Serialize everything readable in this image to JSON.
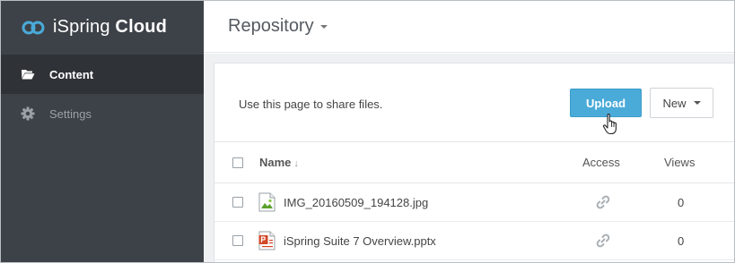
{
  "sidebar": {
    "brand": {
      "name_light": "iSpring",
      "name_bold": "Cloud"
    },
    "items": [
      {
        "label": "Content",
        "icon": "folder-open-icon",
        "active": true
      },
      {
        "label": "Settings",
        "icon": "gear-icon",
        "active": false
      }
    ]
  },
  "header": {
    "title": "Repository"
  },
  "panel": {
    "intro": "Use this page to share files.",
    "upload_label": "Upload",
    "new_label": "New"
  },
  "table": {
    "columns": {
      "name": "Name",
      "access": "Access",
      "views": "Views"
    },
    "rows": [
      {
        "name": "IMG_20160509_194128.jpg",
        "type": "image",
        "views": "0"
      },
      {
        "name": "iSpring Suite 7 Overview.pptx",
        "type": "pptx",
        "views": "0"
      }
    ]
  },
  "colors": {
    "sidebar": "#3d4248",
    "sidebar_active": "#2f3337",
    "accent": "#4aaad8",
    "logo": "#4aaad8",
    "pptx": "#d24726",
    "image": "#5aa02c"
  }
}
